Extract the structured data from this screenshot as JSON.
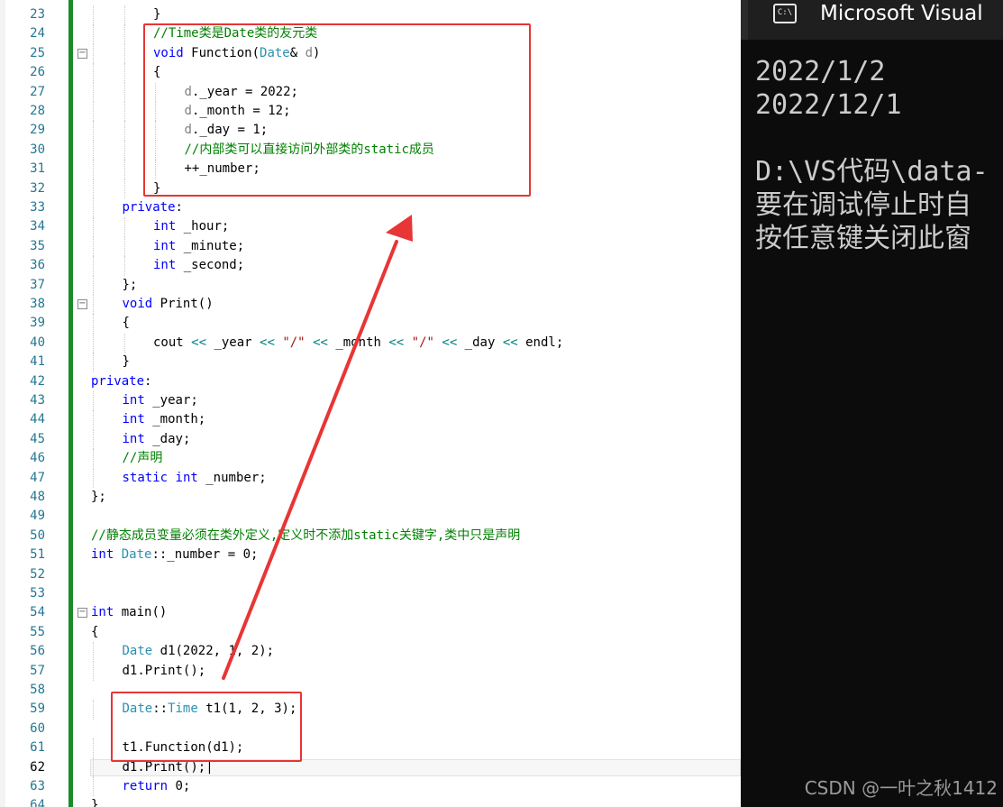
{
  "editor": {
    "lines": [
      {
        "n": "23",
        "indent": 2,
        "tokens": [
          {
            "t": "}",
            "c": ""
          }
        ]
      },
      {
        "n": "24",
        "indent": 2,
        "tokens": [
          {
            "t": "//Time类是Date类的友元类",
            "c": "cm"
          }
        ]
      },
      {
        "n": "25",
        "indent": 2,
        "fold": "−",
        "tokens": [
          {
            "t": "void",
            "c": "kw"
          },
          {
            "t": " Function(",
            "c": ""
          },
          {
            "t": "Date",
            "c": "ty"
          },
          {
            "t": "& ",
            "c": ""
          },
          {
            "t": "d",
            "c": "pm"
          },
          {
            "t": ")",
            "c": ""
          }
        ]
      },
      {
        "n": "26",
        "indent": 2,
        "tokens": [
          {
            "t": "{",
            "c": ""
          }
        ]
      },
      {
        "n": "27",
        "indent": 3,
        "tokens": [
          {
            "t": "d",
            "c": "pm"
          },
          {
            "t": "._year = 2022;",
            "c": ""
          }
        ]
      },
      {
        "n": "28",
        "indent": 3,
        "tokens": [
          {
            "t": "d",
            "c": "pm"
          },
          {
            "t": "._month = 12;",
            "c": ""
          }
        ]
      },
      {
        "n": "29",
        "indent": 3,
        "tokens": [
          {
            "t": "d",
            "c": "pm"
          },
          {
            "t": "._day = 1;",
            "c": ""
          }
        ]
      },
      {
        "n": "30",
        "indent": 3,
        "tokens": [
          {
            "t": "//内部类可以直接访问外部类的static成员",
            "c": "cm"
          }
        ]
      },
      {
        "n": "31",
        "indent": 3,
        "tokens": [
          {
            "t": "++_number;",
            "c": ""
          }
        ]
      },
      {
        "n": "32",
        "indent": 2,
        "tokens": [
          {
            "t": "}",
            "c": ""
          }
        ]
      },
      {
        "n": "33",
        "indent": 1,
        "tokens": [
          {
            "t": "private",
            "c": "kw"
          },
          {
            "t": ":",
            "c": ""
          }
        ]
      },
      {
        "n": "34",
        "indent": 2,
        "tokens": [
          {
            "t": "int",
            "c": "kw"
          },
          {
            "t": " _hour;",
            "c": ""
          }
        ]
      },
      {
        "n": "35",
        "indent": 2,
        "tokens": [
          {
            "t": "int",
            "c": "kw"
          },
          {
            "t": " _minute;",
            "c": ""
          }
        ]
      },
      {
        "n": "36",
        "indent": 2,
        "tokens": [
          {
            "t": "int",
            "c": "kw"
          },
          {
            "t": " _second;",
            "c": ""
          }
        ]
      },
      {
        "n": "37",
        "indent": 1,
        "tokens": [
          {
            "t": "};",
            "c": ""
          }
        ]
      },
      {
        "n": "38",
        "indent": 1,
        "fold": "−",
        "tokens": [
          {
            "t": "void",
            "c": "kw"
          },
          {
            "t": " Print()",
            "c": ""
          }
        ]
      },
      {
        "n": "39",
        "indent": 1,
        "tokens": [
          {
            "t": "{",
            "c": ""
          }
        ]
      },
      {
        "n": "40",
        "indent": 2,
        "tokens": [
          {
            "t": "cout ",
            "c": ""
          },
          {
            "t": "<<",
            "c": "op"
          },
          {
            "t": " _year ",
            "c": ""
          },
          {
            "t": "<<",
            "c": "op"
          },
          {
            "t": " ",
            "c": ""
          },
          {
            "t": "\"/\"",
            "c": "st"
          },
          {
            "t": " ",
            "c": ""
          },
          {
            "t": "<<",
            "c": "op"
          },
          {
            "t": " _month ",
            "c": ""
          },
          {
            "t": "<<",
            "c": "op"
          },
          {
            "t": " ",
            "c": ""
          },
          {
            "t": "\"/\"",
            "c": "st"
          },
          {
            "t": " ",
            "c": ""
          },
          {
            "t": "<<",
            "c": "op"
          },
          {
            "t": " _day ",
            "c": ""
          },
          {
            "t": "<<",
            "c": "op"
          },
          {
            "t": " endl;",
            "c": ""
          }
        ]
      },
      {
        "n": "41",
        "indent": 1,
        "tokens": [
          {
            "t": "}",
            "c": ""
          }
        ]
      },
      {
        "n": "42",
        "indent": 0,
        "tokens": [
          {
            "t": "private",
            "c": "kw"
          },
          {
            "t": ":",
            "c": ""
          }
        ]
      },
      {
        "n": "43",
        "indent": 1,
        "tokens": [
          {
            "t": "int",
            "c": "kw"
          },
          {
            "t": " _year;",
            "c": ""
          }
        ]
      },
      {
        "n": "44",
        "indent": 1,
        "tokens": [
          {
            "t": "int",
            "c": "kw"
          },
          {
            "t": " _month;",
            "c": ""
          }
        ]
      },
      {
        "n": "45",
        "indent": 1,
        "tokens": [
          {
            "t": "int",
            "c": "kw"
          },
          {
            "t": " _day;",
            "c": ""
          }
        ]
      },
      {
        "n": "46",
        "indent": 1,
        "tokens": [
          {
            "t": "//声明",
            "c": "cm"
          }
        ]
      },
      {
        "n": "47",
        "indent": 1,
        "tokens": [
          {
            "t": "static",
            "c": "kw"
          },
          {
            "t": " ",
            "c": ""
          },
          {
            "t": "int",
            "c": "kw"
          },
          {
            "t": " _number;",
            "c": ""
          }
        ]
      },
      {
        "n": "48",
        "indent": 0,
        "tokens": [
          {
            "t": "};",
            "c": ""
          }
        ]
      },
      {
        "n": "49",
        "indent": 0,
        "tokens": []
      },
      {
        "n": "50",
        "indent": 0,
        "tokens": [
          {
            "t": "//静态成员变量必须在类外定义,定义时不添加static关键字,类中只是声明",
            "c": "cm"
          }
        ]
      },
      {
        "n": "51",
        "indent": 0,
        "tokens": [
          {
            "t": "int",
            "c": "kw"
          },
          {
            "t": " ",
            "c": ""
          },
          {
            "t": "Date",
            "c": "ty"
          },
          {
            "t": "::_number = 0;",
            "c": ""
          }
        ]
      },
      {
        "n": "52",
        "indent": 0,
        "tokens": []
      },
      {
        "n": "53",
        "indent": 0,
        "tokens": []
      },
      {
        "n": "54",
        "indent": 0,
        "fold": "−",
        "tokens": [
          {
            "t": "int",
            "c": "kw"
          },
          {
            "t": " main()",
            "c": ""
          }
        ]
      },
      {
        "n": "55",
        "indent": 0,
        "tokens": [
          {
            "t": "{",
            "c": ""
          }
        ]
      },
      {
        "n": "56",
        "indent": 1,
        "tokens": [
          {
            "t": "Date",
            "c": "ty"
          },
          {
            "t": " d1(2022, 1, 2);",
            "c": ""
          }
        ]
      },
      {
        "n": "57",
        "indent": 1,
        "tokens": [
          {
            "t": "d1.Print();",
            "c": ""
          }
        ]
      },
      {
        "n": "58",
        "indent": 0,
        "tokens": []
      },
      {
        "n": "59",
        "indent": 1,
        "tokens": [
          {
            "t": "Date",
            "c": "ty"
          },
          {
            "t": "::",
            "c": ""
          },
          {
            "t": "Time",
            "c": "ty"
          },
          {
            "t": " t1(1, 2, 3);",
            "c": ""
          }
        ]
      },
      {
        "n": "60",
        "indent": 0,
        "tokens": []
      },
      {
        "n": "61",
        "indent": 1,
        "tokens": [
          {
            "t": "t1.Function(d1);",
            "c": ""
          }
        ]
      },
      {
        "n": "62",
        "indent": 1,
        "current": true,
        "tokens": [
          {
            "t": "d1.Print();",
            "c": ""
          }
        ]
      },
      {
        "n": "63",
        "indent": 1,
        "tokens": [
          {
            "t": "return",
            "c": "kw"
          },
          {
            "t": " 0;",
            "c": ""
          }
        ]
      },
      {
        "n": "64",
        "indent": 0,
        "tokens": [
          {
            "t": "}",
            "c": ""
          }
        ]
      }
    ]
  },
  "console": {
    "title": "Microsoft Visual",
    "icon_label": "C:\\",
    "output": [
      "2022/1/2",
      "2022/12/1",
      "",
      "D:\\VS代码\\data-",
      "要在调试停止时自",
      "按任意键关闭此窗"
    ]
  },
  "annotations": {
    "color": "#e83535"
  },
  "watermark": "CSDN @一叶之秋1412"
}
